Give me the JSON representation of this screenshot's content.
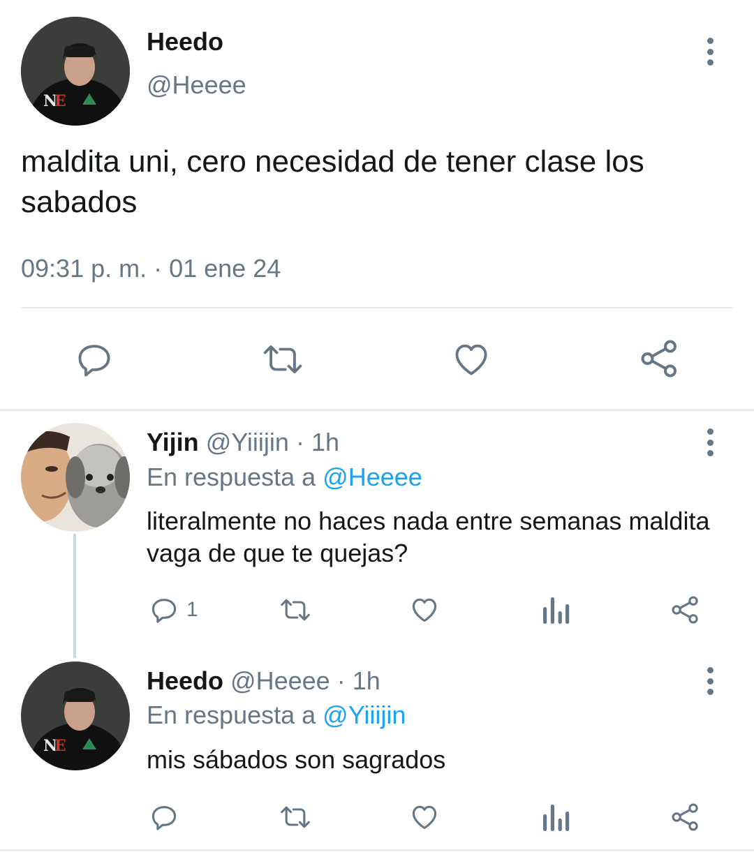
{
  "main_tweet": {
    "name": "Heedo",
    "handle": "@Heeee",
    "text": "maldita uni, cero necesidad de tener clase los sabados",
    "timestamp": "09:31 p. m. · 01 ene 24",
    "avatar_icon": "avatar-photo",
    "actions": [
      "reply-icon",
      "retweet-icon",
      "like-icon",
      "share-icon"
    ]
  },
  "replies": [
    {
      "name": "Yijin",
      "handle": "@Yiiijin",
      "separator": "·",
      "time": "1h",
      "reply_prefix": "En respuesta a",
      "reply_to": "@Heeee",
      "text": "literalmente no haces nada entre semanas maldita vaga de que te quejas?",
      "reply_count": "1"
    },
    {
      "name": "Heedo",
      "handle": "@Heeee",
      "separator": "·",
      "time": "1h",
      "reply_prefix": "En respuesta a",
      "reply_to": "@Yiiijin",
      "text": "mis sábados son sagrados",
      "reply_count": ""
    }
  ],
  "colors": {
    "text": "#14171a",
    "muted": "#657786",
    "link": "#1da1f2",
    "divider": "#e1e8ed"
  }
}
